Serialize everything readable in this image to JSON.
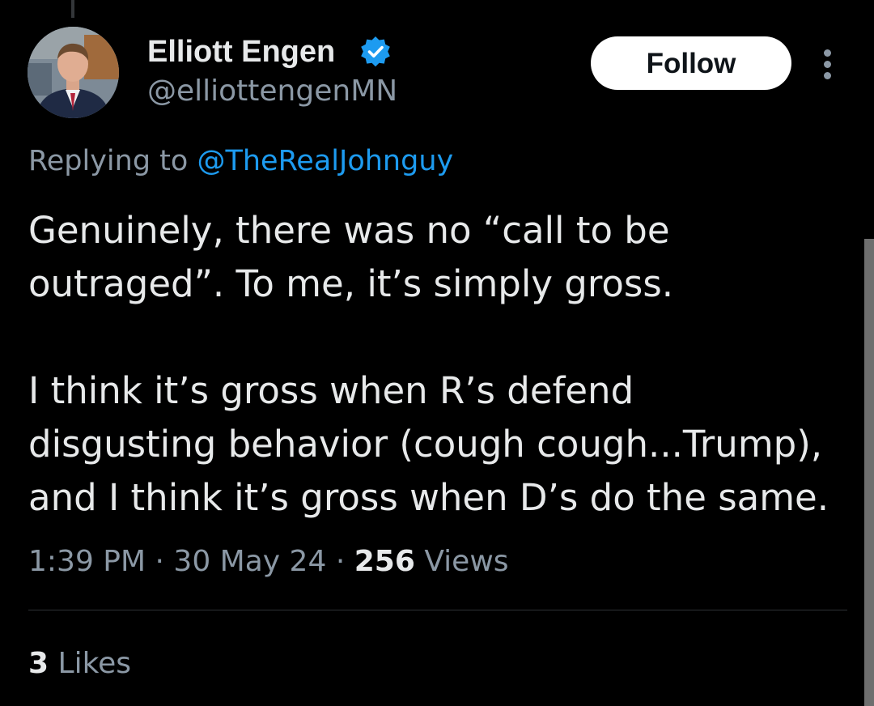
{
  "tweet": {
    "author": {
      "display_name": "Elliott Engen",
      "handle": "@elliottengenMN",
      "verified_icon": "verified-badge-icon",
      "avatar_icon": "profile-photo"
    },
    "follow_label": "Follow",
    "more_icon": "more-vertical-icon",
    "replying_prefix": "Replying to",
    "replying_to": "@TheRealJohnguy",
    "text_lines": [
      "Genuinely, there was no “call to be",
      "outraged”. To me, it’s simply gross.",
      "I think it’s gross when R’s defend",
      "disgusting behavior (cough cough...Trump),",
      "and I think it’s gross when D’s do the same."
    ],
    "time": "1:39 PM",
    "separator": "·",
    "date": "30 May 24",
    "views_count": "256",
    "views_label": "Views",
    "likes_count": "3",
    "likes_label": "Likes"
  },
  "colors": {
    "background": "#000000",
    "text_primary": "#e7e9ea",
    "text_secondary": "#8b98a5",
    "link": "#1d9bf0",
    "verified": "#1d9bf0",
    "divider": "#2f3336",
    "follow_bg": "#ffffff",
    "follow_text": "#0f1419"
  }
}
